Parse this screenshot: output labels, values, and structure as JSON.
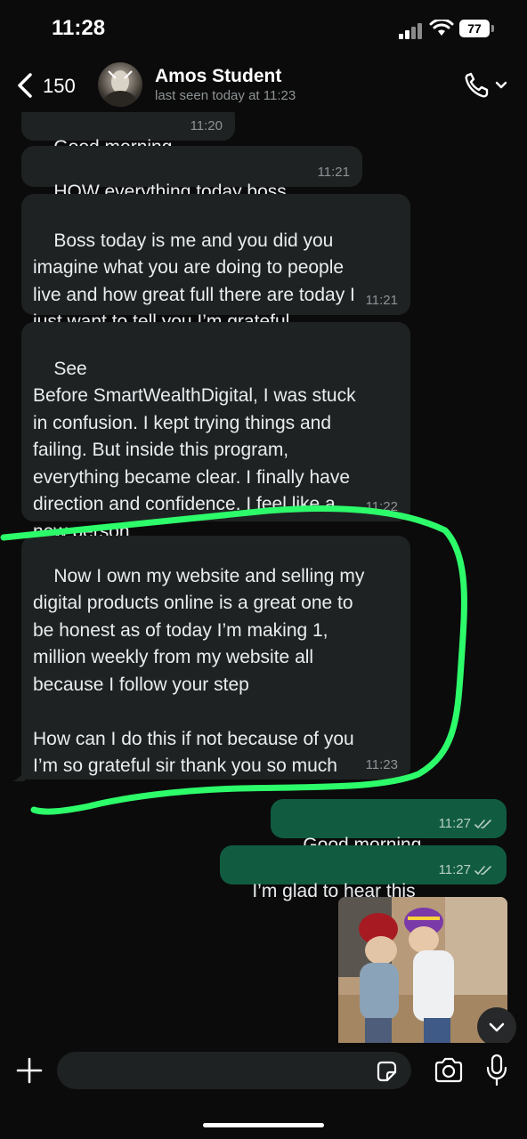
{
  "status_bar": {
    "time": "11:28",
    "battery": "77"
  },
  "header": {
    "back_count": "150",
    "contact_name": "Amos Student",
    "last_seen": "last seen today at 11:23"
  },
  "messages": [
    {
      "dir": "in",
      "text": "Good morning",
      "time": "11:20"
    },
    {
      "dir": "in",
      "text": "HOW everything today boss",
      "time": "11:21"
    },
    {
      "dir": "in",
      "text": "Boss today is me and you did you\nimagine what you are doing to people\nlive and how great full there are today I\njust want to tell you I’m grateful",
      "time": "11:21"
    },
    {
      "dir": "in",
      "text": "See\nBefore SmartWealthDigital, I was stuck\nin confusion. I kept trying things and\nfailing. But inside this program,\neverything became clear. I finally have\ndirection and confidence. I feel like a\nnew person",
      "time": "11:22"
    },
    {
      "dir": "in",
      "text": "Now I own my website and selling my\ndigital products online is a great one to\nbe honest as of today I’m making 1,\nmillion weekly from my website all\nbecause I follow your step\n\nHow can I do this if not because of you\nI’m so grateful sir thank you so much",
      "time": "11:23"
    },
    {
      "dir": "out",
      "text": "Good morning",
      "time": "11:27"
    },
    {
      "dir": "out",
      "text": "I’m glad to hear this",
      "time": "11:27"
    }
  ],
  "icons": [
    "back-chevron-icon",
    "phone-icon",
    "chevron-down-icon",
    "plus-icon",
    "sticker-icon",
    "camera-icon",
    "microphone-icon",
    "read-ticks-icon",
    "scroll-down-icon"
  ],
  "colors": {
    "incoming_bubble": "#1f2223",
    "outgoing_bubble": "#115c40",
    "highlight_stroke": "#2dfc6a",
    "background": "#0b0b0b"
  }
}
